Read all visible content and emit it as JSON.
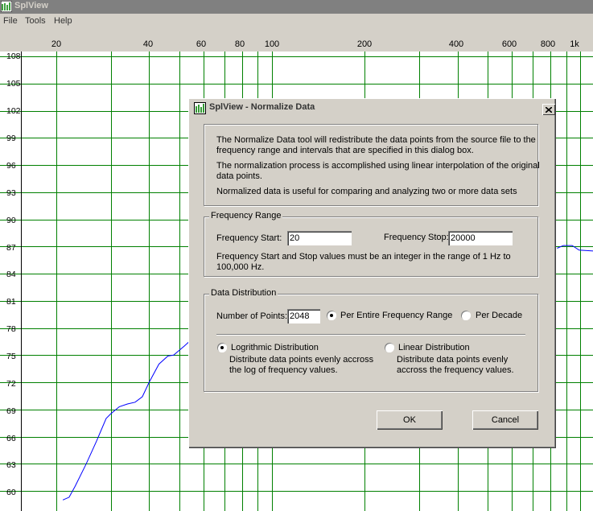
{
  "app": {
    "title": "SplView"
  },
  "menu": [
    "File",
    "Tools",
    "Help"
  ],
  "colors": {
    "grid": "#008000",
    "curve": "#0000ff",
    "face": "#d4d0c8"
  },
  "chart_data": {
    "type": "line",
    "x_ticks": [
      "20",
      "40",
      "60",
      "80",
      "100",
      "200",
      "400",
      "600",
      "800",
      "1k"
    ],
    "y_ticks": [
      "108",
      "105",
      "102",
      "99",
      "96",
      "93",
      "90",
      "87",
      "84",
      "81",
      "78",
      "75",
      "72",
      "69",
      "66",
      "63",
      "60"
    ],
    "x_scale": "log",
    "series": [
      {
        "points": [
          [
            21,
            59
          ],
          [
            22,
            59.3
          ],
          [
            23,
            60.5
          ],
          [
            25,
            63
          ],
          [
            27,
            65.5
          ],
          [
            29,
            68
          ],
          [
            30,
            68.5
          ],
          [
            32,
            69.3
          ],
          [
            34,
            69.6
          ],
          [
            36,
            69.8
          ],
          [
            38,
            70.4
          ],
          [
            40,
            72
          ],
          [
            43,
            74
          ],
          [
            46,
            74.9
          ],
          [
            48,
            75
          ],
          [
            52,
            76
          ],
          [
            56,
            77
          ]
        ]
      },
      {
        "points": [
          [
            840,
            86.8
          ],
          [
            880,
            87.1
          ],
          [
            940,
            87.1
          ],
          [
            990,
            86.6
          ],
          [
            1100,
            86.5
          ]
        ]
      }
    ]
  },
  "dialog": {
    "title": "SplView - Normalize Data",
    "info": [
      "The Normalize Data tool will redistribute the data points from the source file to the",
      "frequency range and intervals that are specified in this dialog box.",
      "The normalization process is accomplished using linear interpolation of the original",
      "data points.",
      "Normalized data is useful for comparing and analyzing two or more data sets"
    ],
    "freq": {
      "legend": "Frequency Range",
      "start_label": "Frequency Start:",
      "start_value": "20",
      "stop_label": "Frequency Stop:",
      "stop_value": "20000",
      "note_1": "Frequency Start and Stop values must be an integer in the range of 1 Hz to",
      "note_2": "100,000  Hz."
    },
    "dist": {
      "legend": "Data Distribution",
      "points_label": "Number of Points:",
      "points_value": "2048",
      "per_range": "Per Entire Frequency Range",
      "per_decade": "Per Decade",
      "log_label": "Logrithmic Distribution",
      "log_desc_1": "Distribute data points evenly accross",
      "log_desc_2": "the log of frequency values.",
      "lin_label": "Linear Distribution",
      "lin_desc_1": "Distribute data points evenly",
      "lin_desc_2": "accross the frequency values."
    },
    "ok": "OK",
    "cancel": "Cancel"
  }
}
